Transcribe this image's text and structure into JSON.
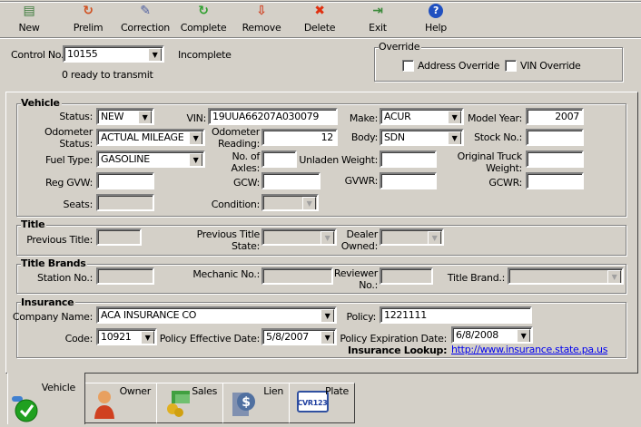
{
  "toolbar": {
    "items": [
      {
        "label": "New",
        "icon": "new-document-icon",
        "color": "#3a7a3a",
        "glyph": "▤"
      },
      {
        "label": "Prelim",
        "icon": "prelim-icon",
        "color": "#d05020",
        "glyph": "↻"
      },
      {
        "label": "Correction",
        "icon": "correction-icon",
        "color": "#5060a0",
        "glyph": "✎"
      },
      {
        "label": "Complete",
        "icon": "complete-icon",
        "color": "#30a030",
        "glyph": "↻"
      },
      {
        "label": "Remove",
        "icon": "remove-icon",
        "color": "#d04020",
        "glyph": "⇩"
      },
      {
        "label": "Delete",
        "icon": "delete-icon",
        "color": "#e03010",
        "glyph": "✖"
      },
      {
        "label": "Exit",
        "icon": "exit-icon",
        "color": "#3a8a3a",
        "glyph": "⇥"
      },
      {
        "label": "Help",
        "icon": "help-icon",
        "color": "#2050c0",
        "glyph": "?"
      }
    ]
  },
  "header": {
    "control_label": "Control No.",
    "control_value": "10155",
    "status": "Incomplete",
    "ready": "0 ready to transmit"
  },
  "override": {
    "title": "Override",
    "address": "Address Override",
    "vin": "VIN Override",
    "address_checked": false,
    "vin_checked": false
  },
  "vehicle": {
    "title": "Vehicle",
    "status_label": "Status:",
    "status": "NEW",
    "vin_label": "VIN:",
    "vin": "19UUA66207A030079",
    "make_label": "Make:",
    "make": "ACUR",
    "model_year_label": "Model Year:",
    "model_year": "2007",
    "odo_status_label1": "Odometer",
    "odo_status_label2": "Status:",
    "odo_status": "ACTUAL MILEAGE",
    "odo_reading_label1": "Odometer",
    "odo_reading_label2": "Reading:",
    "odo_reading": "12",
    "body_label": "Body:",
    "body": "SDN",
    "stock_label": "Stock No.:",
    "stock": "",
    "fuel_label": "Fuel Type:",
    "fuel": "GASOLINE",
    "axles_label1": "No. of",
    "axles_label2": "Axles:",
    "axles": "",
    "unladen_label": "Unladen Weight:",
    "unladen": "",
    "otw_label1": "Original Truck",
    "otw_label2": "Weight:",
    "otw": "",
    "reg_gvw_label": "Reg GVW:",
    "reg_gvw": "",
    "gcw_label": "GCW:",
    "gcw": "",
    "gvwr_label": "GVWR:",
    "gvwr": "",
    "gcwr_label": "GCWR:",
    "gcwr": "",
    "seats_label": "Seats:",
    "seats": "",
    "condition_label": "Condition:",
    "condition": ""
  },
  "title": {
    "title": "Title",
    "prev_title_label": "Previous Title:",
    "prev_state_label1": "Previous Title",
    "prev_state_label2": "State:",
    "dealer_label1": "Dealer",
    "dealer_label2": "Owned:"
  },
  "brands": {
    "title": "Title Brands",
    "station_label": "Station No.:",
    "mechanic_label": "Mechanic No.:",
    "reviewer_label1": "Reviewer",
    "reviewer_label2": "No.:",
    "brand_label": "Title Brand.:"
  },
  "insurance": {
    "title": "Insurance",
    "company_label": "Company Name:",
    "company": "ACA INSURANCE CO",
    "policy_label": "Policy:",
    "policy": "1221111",
    "code_label": "Code:",
    "code": "10921",
    "eff_label": "Policy Effective Date:",
    "eff": "5/8/2007",
    "exp_label": "Policy Expiration Date:",
    "exp": "6/8/2008",
    "lookup_label": "Insurance Lookup:",
    "lookup_url": "http://www.insurance.state.pa.us"
  },
  "tabs": [
    {
      "label": "Vehicle",
      "icon": "vehicle-check-icon"
    },
    {
      "label": "Owner",
      "icon": "owner-person-icon"
    },
    {
      "label": "Sales",
      "icon": "sales-money-icon"
    },
    {
      "label": "Lien",
      "icon": "lien-dollar-icon"
    },
    {
      "label": "Plate",
      "icon": "plate-icon",
      "plate_text": "CVR123"
    }
  ]
}
